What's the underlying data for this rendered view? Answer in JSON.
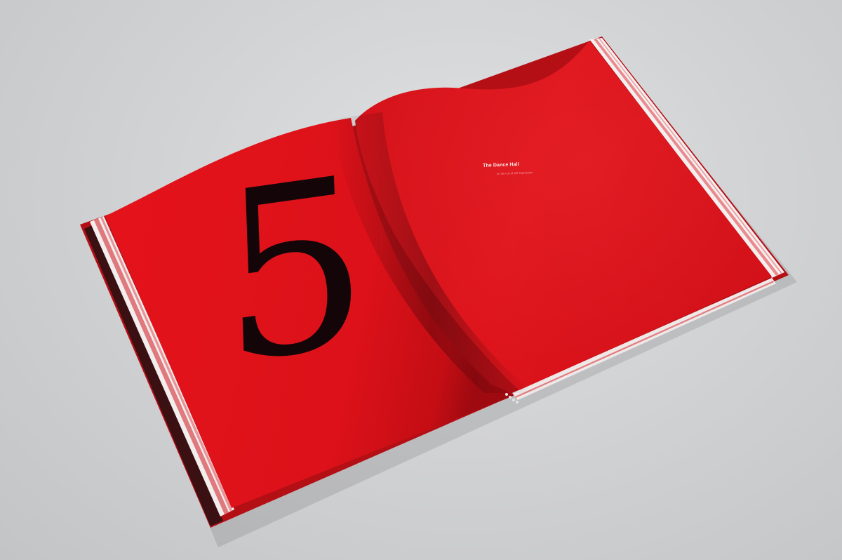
{
  "book": {
    "chapter_number": "5",
    "chapter_title": "The Dance Hall",
    "chapter_subtitle": "on the cult of self-expression"
  },
  "colors": {
    "background": "#cfd0d2",
    "page_red": "#d8121a",
    "cover_red": "#b50f16",
    "numeral": "#140608",
    "title_text": "#fbe9e9"
  }
}
